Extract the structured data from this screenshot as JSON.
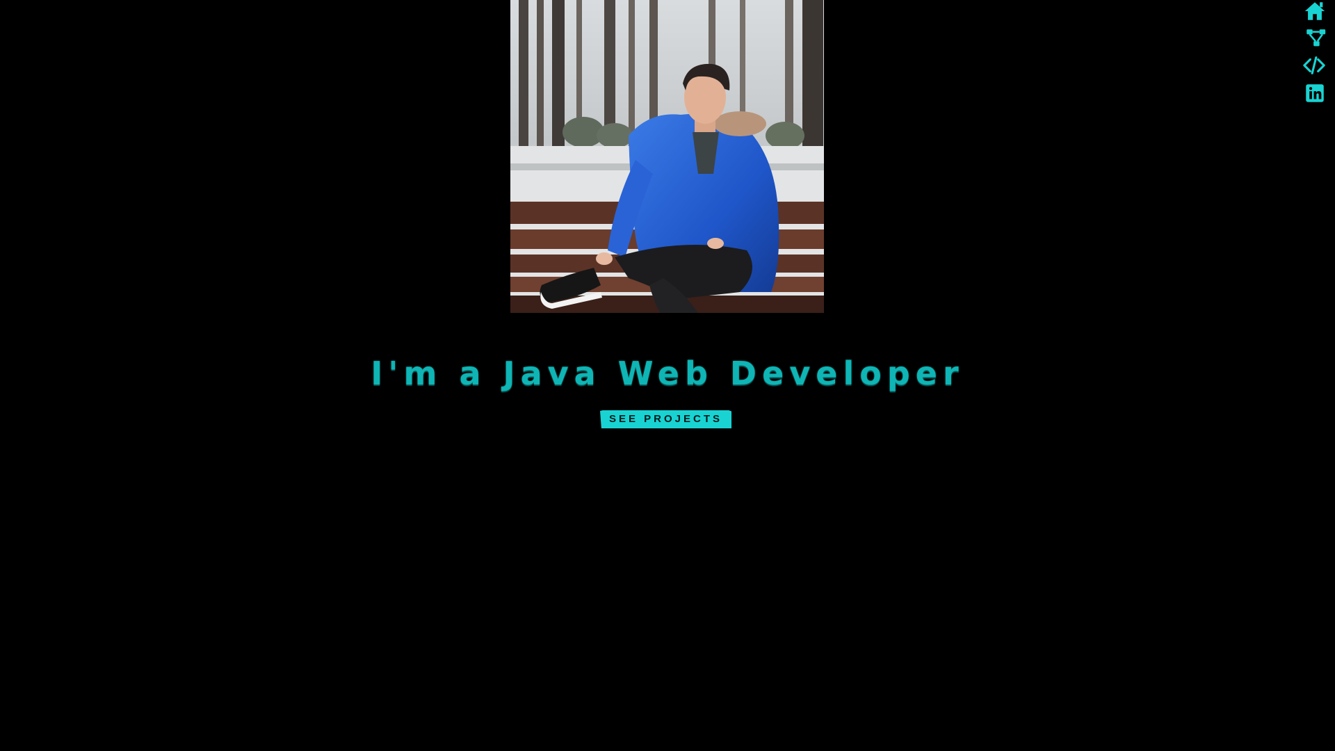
{
  "hero": {
    "headline": "I'm a Java Web Developer",
    "cta_label": "SEE PROJECTS"
  },
  "nav": {
    "items": [
      {
        "icon": "home-icon",
        "target": "home"
      },
      {
        "icon": "share-nodes-icon",
        "target": "skills"
      },
      {
        "icon": "code-icon",
        "target": "projects"
      },
      {
        "icon": "linkedin-icon",
        "target": "linkedin"
      }
    ]
  },
  "colors": {
    "background": "#000000",
    "accent": "#19d3d3",
    "headline": "#0fb5b5"
  }
}
